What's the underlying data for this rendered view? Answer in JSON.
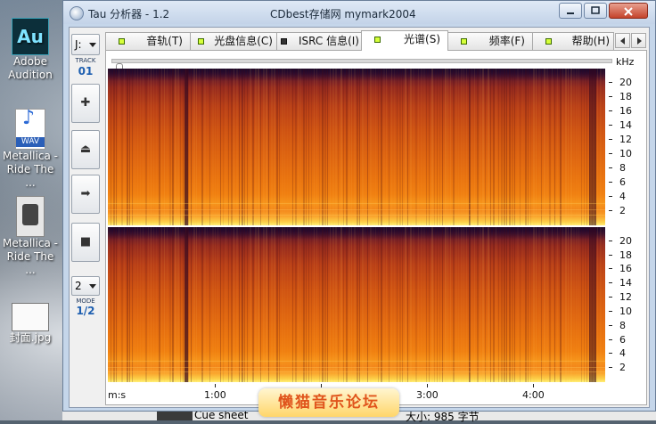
{
  "desktop": {
    "icons": [
      {
        "label_line1": "Adobe",
        "label_line2": "Audition",
        "badge": "Au",
        "icon": "adobe-audition-icon"
      },
      {
        "label_line1": "Metallica -",
        "label_line2": "Ride The ...",
        "badge": "WAV",
        "icon": "wav-file-icon"
      },
      {
        "label_line1": "Metallica -",
        "label_line2": "Ride The ...",
        "badge": "",
        "icon": "cue-file-icon"
      },
      {
        "label_line1": "封面.jpg",
        "label_line2": "",
        "badge": "",
        "icon": "jpg-file-icon"
      }
    ],
    "behind_window": {
      "cue_label": "Cue sheet",
      "size_label": "大小: 985 字节"
    }
  },
  "window": {
    "title": "Tau 分析器 - 1.2",
    "center_title": "CDbest存储网 mymark2004"
  },
  "toolbar": {
    "drive": "J:",
    "track_label": "TRACK",
    "track_number": "01",
    "mode": "2",
    "mode_label": "MODE",
    "mode_value": "1/2"
  },
  "tabs": [
    {
      "label": "音轨(T)",
      "active": false
    },
    {
      "label": "光盘信息(C)",
      "active": false
    },
    {
      "label": "ISRC 信息(I)",
      "active": false
    },
    {
      "label": "光谱(S)",
      "active": true
    },
    {
      "label": "频率(F)",
      "active": false
    },
    {
      "label": "帮助(H)",
      "active": false
    }
  ],
  "spectrogram": {
    "unit": "kHz",
    "y_ticks": [
      "20",
      "18",
      "16",
      "14",
      "12",
      "10",
      "8",
      "6",
      "4",
      "2"
    ],
    "x_axis_label": "m:s",
    "x_ticks": [
      "1:00",
      "2:00",
      "3:00",
      "4:00"
    ],
    "channels": 2
  },
  "watermark": "懒猫音乐论坛"
}
